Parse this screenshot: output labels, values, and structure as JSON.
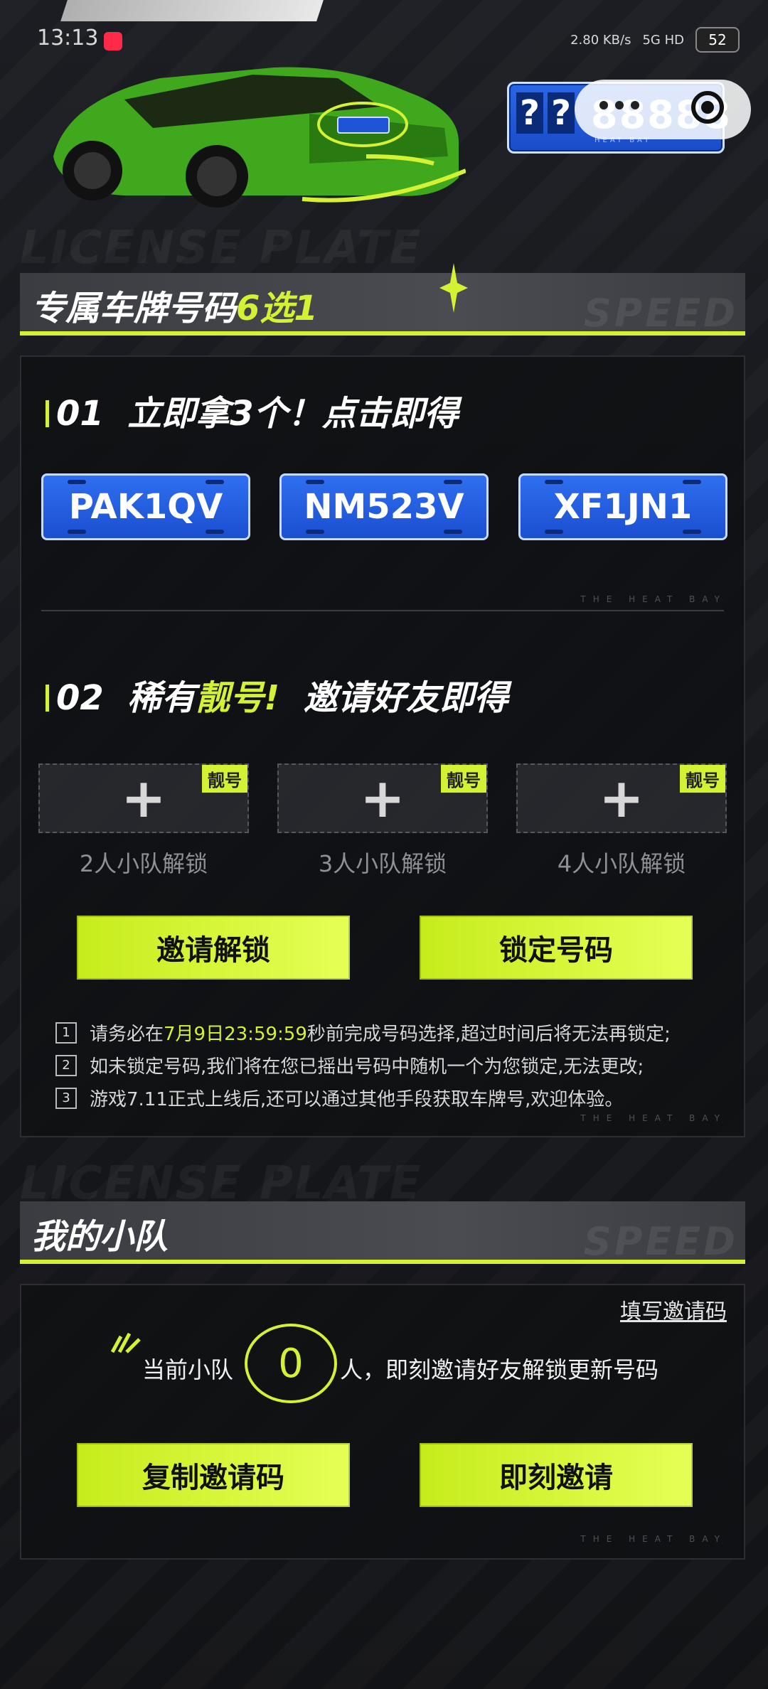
{
  "status": {
    "time": "13:13",
    "app_badge": "小红书",
    "speed": "2.80 KB/s",
    "network": "5G HD",
    "battery": "52"
  },
  "hero": {
    "plate_prefix": [
      "?",
      "?"
    ],
    "plate_number": "88888",
    "plate_sub": "HEAT BAY"
  },
  "section1": {
    "title_prefix": "专属车牌号码",
    "title_highlight": "6选1",
    "ghost_word": "SPEED",
    "bg_lettering": "LICENSE PLATE"
  },
  "step1": {
    "number": "01",
    "title": "立即拿3个！点击即得",
    "plates": [
      "PAK1QV",
      "NM523V",
      "XF1JN1"
    ],
    "deco": "THE HEAT BAY"
  },
  "step2": {
    "number": "02",
    "title_a": "稀有",
    "title_highlight": "靓号!",
    "title_b": "邀请好友即得",
    "slots": [
      {
        "tag": "靓号",
        "plus": "+",
        "label": "2人小队解锁"
      },
      {
        "tag": "靓号",
        "plus": "+",
        "label": "3人小队解锁"
      },
      {
        "tag": "靓号",
        "plus": "+",
        "label": "4人小队解锁"
      }
    ],
    "buttons": {
      "invite_unlock": "邀请解锁",
      "lock_number": "锁定号码"
    },
    "rules": [
      {
        "n": "1",
        "pre": "请务必在",
        "highlight": "7月9日23:59:59",
        "post": "秒前完成号码选择,超过时间后将无法再锁定;"
      },
      {
        "n": "2",
        "pre": "如未锁定号码,我们将在您已摇出号码中随机一个为您锁定,无法更改;",
        "highlight": "",
        "post": ""
      },
      {
        "n": "3",
        "pre": "游戏7.11正式上线后,还可以通过其他手段获取车牌号,欢迎体验。",
        "highlight": "",
        "post": ""
      }
    ],
    "deco": "THE HEAT BAY"
  },
  "section2": {
    "title": "我的小队",
    "ghost_word": "SPEED",
    "bg_lettering": "LICENSE PLATE"
  },
  "team": {
    "fill_code_link": "填写邀请码",
    "line_a": "当前小队",
    "count": "0",
    "line_b": "人，即刻邀请好友解锁更新号码",
    "buttons": {
      "copy_code": "复制邀请码",
      "invite_now": "即刻邀请"
    },
    "deco": "THE HEAT BAY"
  },
  "colors": {
    "accent": "#d4f233",
    "plate_blue": "#1a4fd0",
    "background": "#16181c"
  }
}
